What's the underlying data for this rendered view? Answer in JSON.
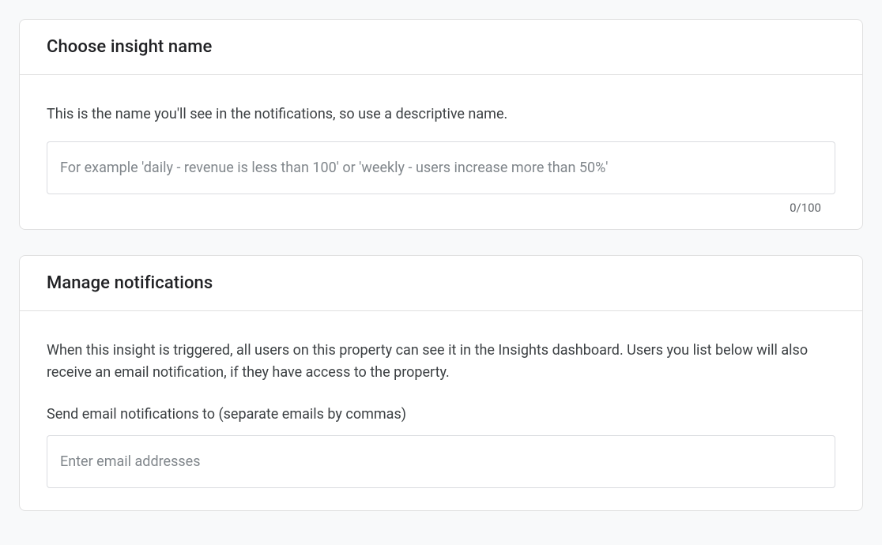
{
  "insight_name": {
    "title": "Choose insight name",
    "description": "This is the name you'll see in the notifications, so use a descriptive name.",
    "input_placeholder": "For example 'daily - revenue is less than 100' or 'weekly - users increase more than 50%'",
    "input_value": "",
    "counter": "0/100"
  },
  "notifications": {
    "title": "Manage notifications",
    "description": "When this insight is triggered, all users on this property can see it in the Insights dashboard. Users you list below will also receive an email notification, if they have access to the property.",
    "email_label": "Send email notifications to (separate emails by commas)",
    "email_placeholder": "Enter email addresses",
    "email_value": ""
  }
}
